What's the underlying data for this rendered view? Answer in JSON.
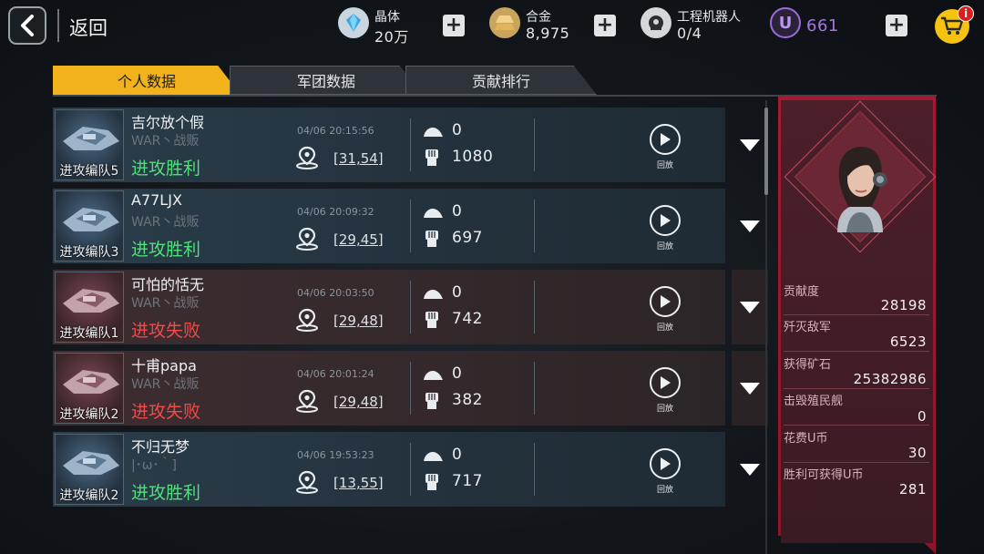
{
  "header": {
    "back_label": "返回",
    "resources": [
      {
        "name": "晶体",
        "value": "20万",
        "icon": "crystal-icon"
      },
      {
        "name": "合金",
        "value": "8,975",
        "icon": "alloy-icon"
      },
      {
        "name": "工程机器人",
        "value": "0/4",
        "icon": "robot-icon"
      }
    ],
    "ucoin": "661",
    "ucoin_symbol": "U",
    "notification_badge": "i"
  },
  "tabs": [
    {
      "label": "个人数据",
      "active": true
    },
    {
      "label": "军团数据",
      "active": false
    },
    {
      "label": "贡献排行",
      "active": false
    }
  ],
  "records": [
    {
      "squad": "进攻编队5",
      "player": "吉尔放个假",
      "guild": "WAR丶战贩",
      "result": "进攻胜利",
      "outcome": "win",
      "time": "04/06 20:15:56",
      "coords": "[31,54]",
      "kills": "0",
      "power": "1080",
      "replay": "回放"
    },
    {
      "squad": "进攻编队3",
      "player": "A77LJX",
      "guild": "WAR丶战贩",
      "result": "进攻胜利",
      "outcome": "win",
      "time": "04/06 20:09:32",
      "coords": "[29,45]",
      "kills": "0",
      "power": "697",
      "replay": "回放"
    },
    {
      "squad": "进攻编队1",
      "player": "可怕的恬无",
      "guild": "WAR丶战贩",
      "result": "进攻失败",
      "outcome": "lose",
      "time": "04/06 20:03:50",
      "coords": "[29,48]",
      "kills": "0",
      "power": "742",
      "replay": "回放"
    },
    {
      "squad": "进攻编队2",
      "player": "十甫papa",
      "guild": "WAR丶战贩",
      "result": "进攻失败",
      "outcome": "lose",
      "time": "04/06 20:01:24",
      "coords": "[29,48]",
      "kills": "0",
      "power": "382",
      "replay": "回放"
    },
    {
      "squad": "进攻编队2",
      "player": "不归无梦",
      "guild": "|･ω･｀]",
      "result": "进攻胜利",
      "outcome": "win",
      "time": "04/06 19:53:23",
      "coords": "[13,55]",
      "kills": "0",
      "power": "717",
      "replay": "回放"
    }
  ],
  "stats": [
    {
      "label": "贡献度",
      "value": "28198"
    },
    {
      "label": "歼灭敌军",
      "value": "6523"
    },
    {
      "label": "获得矿石",
      "value": "25382986"
    },
    {
      "label": "击毁殖民舰",
      "value": "0"
    },
    {
      "label": "花费U币",
      "value": "30"
    },
    {
      "label": "胜利可获得U币",
      "value": "281"
    }
  ],
  "colors": {
    "accent": "#f2b21c",
    "win": "#4fe07a",
    "lose": "#f24a4a",
    "panel": "#a41a33",
    "ucoin": "#9b6bd8"
  }
}
